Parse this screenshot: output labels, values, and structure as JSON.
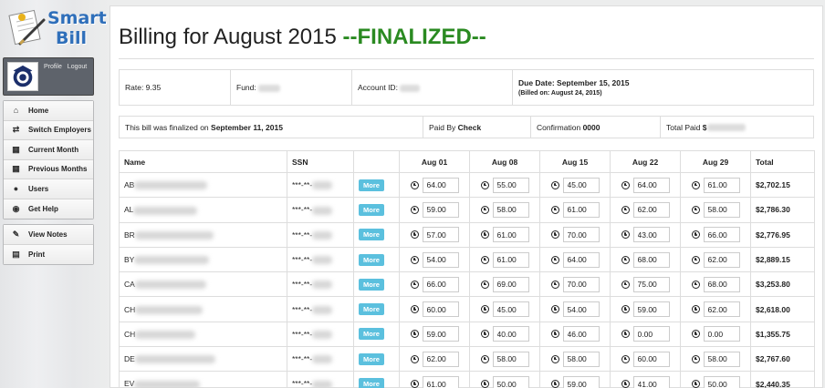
{
  "brand": {
    "line1": "Smart",
    "line2": "Bill"
  },
  "profile": {
    "profile_link": "Profile",
    "logout_link": "Logout"
  },
  "nav": {
    "main": [
      {
        "label": "Home",
        "icon": "home-icon",
        "glyph": "⌂"
      },
      {
        "label": "Switch Employers",
        "icon": "switch-icon",
        "glyph": "⇄"
      },
      {
        "label": "Current Month",
        "icon": "calendar-icon",
        "glyph": "▦"
      },
      {
        "label": "Previous Months",
        "icon": "calendar-grid-icon",
        "glyph": "▦"
      },
      {
        "label": "Users",
        "icon": "user-icon",
        "glyph": "●"
      },
      {
        "label": "Get Help",
        "icon": "help-icon",
        "glyph": "◉"
      }
    ],
    "secondary": [
      {
        "label": "View Notes",
        "icon": "pencil-icon",
        "glyph": "✎"
      },
      {
        "label": "Print",
        "icon": "printer-icon",
        "glyph": "▤"
      }
    ]
  },
  "page": {
    "title": "Billing for August 2015",
    "status": "--FINALIZED--"
  },
  "summary": {
    "rate": "Rate: 9.35",
    "fund_label": "Fund:",
    "account_label": "Account ID:",
    "due_date": "Due Date: September 15, 2015",
    "billed_on": "(Billed on: August 24, 2015)"
  },
  "payment": {
    "finalized_prefix": "This bill was finalized on",
    "finalized_date": "September 11, 2015",
    "paid_by_label": "Paid By",
    "paid_by_value": "Check",
    "confirmation_label": "Confirmation",
    "confirmation_value": "0000",
    "total_paid_label": "Total Paid",
    "total_paid_value": "$"
  },
  "table": {
    "headers": [
      "Name",
      "SSN",
      "",
      "Aug 01",
      "Aug 08",
      "Aug 15",
      "Aug 22",
      "Aug 29",
      "Total"
    ],
    "more_label": "More",
    "rows": [
      {
        "name": "AB",
        "ssn": "***-**-",
        "hours": [
          "64.00",
          "55.00",
          "45.00",
          "64.00",
          "61.00"
        ],
        "total": "$2,702.15"
      },
      {
        "name": "AL",
        "ssn": "***-**-",
        "hours": [
          "59.00",
          "58.00",
          "61.00",
          "62.00",
          "58.00"
        ],
        "total": "$2,786.30"
      },
      {
        "name": "BR",
        "ssn": "***-**-",
        "hours": [
          "57.00",
          "61.00",
          "70.00",
          "43.00",
          "66.00"
        ],
        "total": "$2,776.95"
      },
      {
        "name": "BY",
        "ssn": "***-**-",
        "hours": [
          "54.00",
          "61.00",
          "64.00",
          "68.00",
          "62.00"
        ],
        "total": "$2,889.15"
      },
      {
        "name": "CA",
        "ssn": "***-**-",
        "hours": [
          "66.00",
          "69.00",
          "70.00",
          "75.00",
          "68.00"
        ],
        "total": "$3,253.80"
      },
      {
        "name": "CH",
        "ssn": "***-**-",
        "hours": [
          "60.00",
          "45.00",
          "54.00",
          "59.00",
          "62.00"
        ],
        "total": "$2,618.00"
      },
      {
        "name": "CH",
        "ssn": "***-**-",
        "hours": [
          "59.00",
          "40.00",
          "46.00",
          "0.00",
          "0.00"
        ],
        "total": "$1,355.75"
      },
      {
        "name": "DE",
        "ssn": "***-**-",
        "hours": [
          "62.00",
          "58.00",
          "58.00",
          "60.00",
          "58.00"
        ],
        "total": "$2,767.60"
      },
      {
        "name": "EV",
        "ssn": "***-**-",
        "hours": [
          "61.00",
          "50.00",
          "59.00",
          "41.00",
          "50.00"
        ],
        "total": "$2,440.35"
      }
    ]
  }
}
